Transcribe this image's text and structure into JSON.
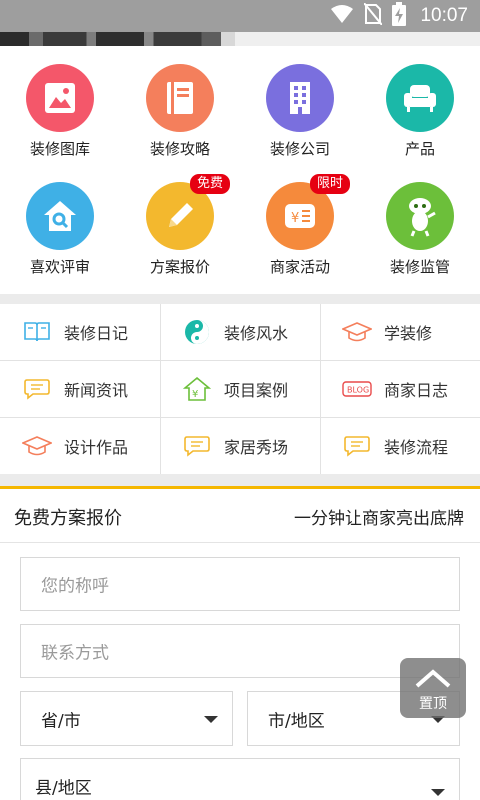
{
  "status_bar": {
    "time": "10:07"
  },
  "icon_grid": [
    {
      "label": "装修图库",
      "icon": "picture-icon",
      "color": "#f4576a"
    },
    {
      "label": "装修攻略",
      "icon": "book-icon",
      "color": "#f47f5c"
    },
    {
      "label": "装修公司",
      "icon": "building-icon",
      "color": "#7a6fde"
    },
    {
      "label": "产品",
      "icon": "sofa-icon",
      "color": "#1bb8a8"
    },
    {
      "label": "喜欢评审",
      "icon": "house-search-icon",
      "color": "#3fb0e6"
    },
    {
      "label": "方案报价",
      "icon": "pencil-icon",
      "color": "#f3b82e",
      "badge": "免费"
    },
    {
      "label": "商家活动",
      "icon": "price-tag-icon",
      "color": "#f58a3c",
      "badge": "限时"
    },
    {
      "label": "装修监管",
      "icon": "mascot-icon",
      "color": "#6cbf3a"
    }
  ],
  "text_grid": [
    {
      "label": "装修日记",
      "icon": "open-book-icon"
    },
    {
      "label": "装修风水",
      "icon": "yin-yang-icon"
    },
    {
      "label": "学装修",
      "icon": "graduation-cap-icon"
    },
    {
      "label": "新闻资讯",
      "icon": "chat-bubble-icon"
    },
    {
      "label": "项目案例",
      "icon": "house-yen-icon"
    },
    {
      "label": "商家日志",
      "icon": "blog-icon",
      "icon_text": "BLOG"
    },
    {
      "label": "设计作品",
      "icon": "graduation-cap-icon"
    },
    {
      "label": "家居秀场",
      "icon": "chat-bubble-icon"
    },
    {
      "label": "装修流程",
      "icon": "chat-bubble-icon"
    }
  ],
  "form": {
    "title": "免费方案报价",
    "subtitle": "一分钟让商家亮出底牌",
    "name_placeholder": "您的称呼",
    "contact_placeholder": "联系方式",
    "province_value": "省/市",
    "city_value": "市/地区",
    "county_value": "县/地区"
  },
  "back_to_top": {
    "label": "置顶"
  }
}
